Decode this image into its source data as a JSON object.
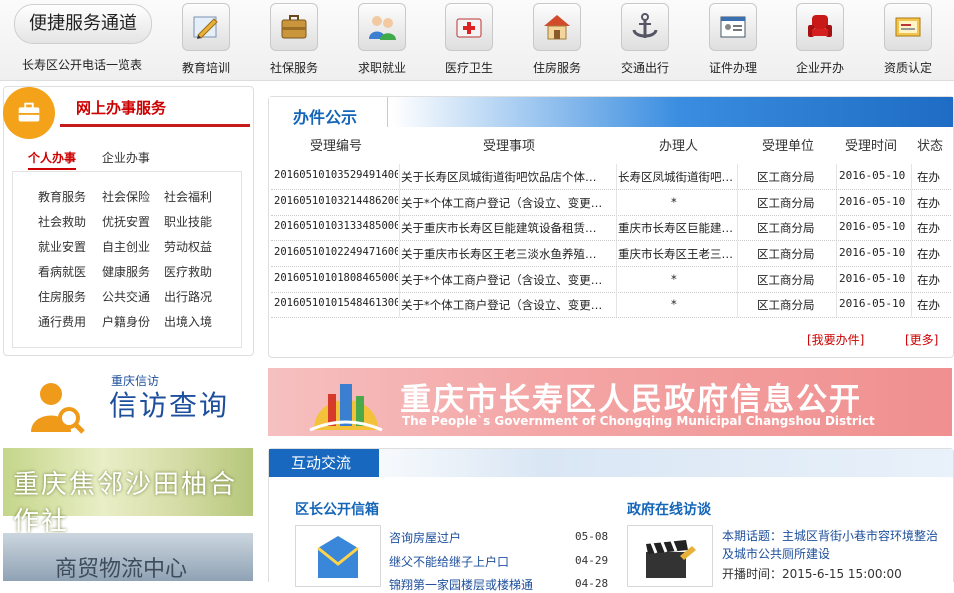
{
  "topbar": {
    "quick_title": "便捷服务通道",
    "phone_link": "长寿区公开电话一览表",
    "services": [
      {
        "label": "教育培训",
        "icon": "pencil-icon"
      },
      {
        "label": "社保服务",
        "icon": "briefcase-icon"
      },
      {
        "label": "求职就业",
        "icon": "people-icon"
      },
      {
        "label": "医疗卫生",
        "icon": "medical-kit-icon"
      },
      {
        "label": "住房服务",
        "icon": "house-icon"
      },
      {
        "label": "交通出行",
        "icon": "anchor-icon"
      },
      {
        "label": "证件办理",
        "icon": "id-card-icon"
      },
      {
        "label": "企业开办",
        "icon": "armchair-icon"
      },
      {
        "label": "资质认定",
        "icon": "certificate-icon"
      }
    ]
  },
  "online_service": {
    "title": "网上办事服务",
    "tabs": [
      "个人办事",
      "企业办事"
    ],
    "items": [
      "教育服务",
      "社会保险",
      "社会福利",
      "社会救助",
      "优抚安置",
      "职业技能",
      "就业安置",
      "自主创业",
      "劳动权益",
      "看病就医",
      "健康服务",
      "医疗救助",
      "住房服务",
      "公共交通",
      "出行路况",
      "通行费用",
      "户籍身份",
      "出境入境"
    ]
  },
  "petition": {
    "small_title": "重庆信访",
    "big_title": "信访查询"
  },
  "pomelo": {
    "text": "重庆焦邻沙田柚合作社"
  },
  "logistics": {
    "text": "商贸物流中心"
  },
  "publicity": {
    "title": "办件公示",
    "columns": [
      "受理编号",
      "受理事项",
      "办理人",
      "受理单位",
      "受理时间",
      "状态"
    ],
    "rows": [
      [
        "20160510103529491400",
        "关于长寿区凤城街道街吧饮品店个体…",
        "长寿区凤城街道街吧…",
        "区工商分局",
        "2016-05-10",
        "在办"
      ],
      [
        "20160510103214486200",
        "关于*个体工商户登记（含设立、变更…",
        "*",
        "区工商分局",
        "2016-05-10",
        "在办"
      ],
      [
        "20160510103133485000",
        "关于重庆市长寿区巨能建筑设备租赁…",
        "重庆市长寿区巨能建…",
        "区工商分局",
        "2016-05-10",
        "在办"
      ],
      [
        "20160510102249471600",
        "关于重庆市长寿区王老三淡水鱼养殖…",
        "重庆市长寿区王老三…",
        "区工商分局",
        "2016-05-10",
        "在办"
      ],
      [
        "20160510101808465000",
        "关于*个体工商户登记（含设立、变更…",
        "*",
        "区工商分局",
        "2016-05-10",
        "在办"
      ],
      [
        "20160510101548461300",
        "关于*个体工商户登记（含设立、变更…",
        "*",
        "区工商分局",
        "2016-05-10",
        "在办"
      ]
    ],
    "my_link": "[我要办件]",
    "more_link": "[更多]"
  },
  "banner": {
    "cn": "重庆市长寿区人民政府信息公开",
    "en": "The People`s Government of Chongqing Municipal Changshou District"
  },
  "interaction": {
    "tab": "互动交流",
    "mailbox_title": "区长公开信箱",
    "mailbox_items": [
      {
        "text": "咨询房屋过户",
        "date": "05-08"
      },
      {
        "text": "继父不能给继子上户口",
        "date": "04-29"
      },
      {
        "text": "锦翔第一家园楼层或楼梯通",
        "date": "04-28"
      }
    ],
    "interview_title": "政府在线访谈",
    "interview_topic": "本期话题：主城区背街小巷市容环境整治及城市公共厕所建设",
    "interview_time": "开播时间：2015-6-15 15:00:00"
  },
  "colors": {
    "accent_blue": "#1868c0",
    "accent_red": "#c61b1b",
    "badge_orange": "#f3a21a"
  }
}
